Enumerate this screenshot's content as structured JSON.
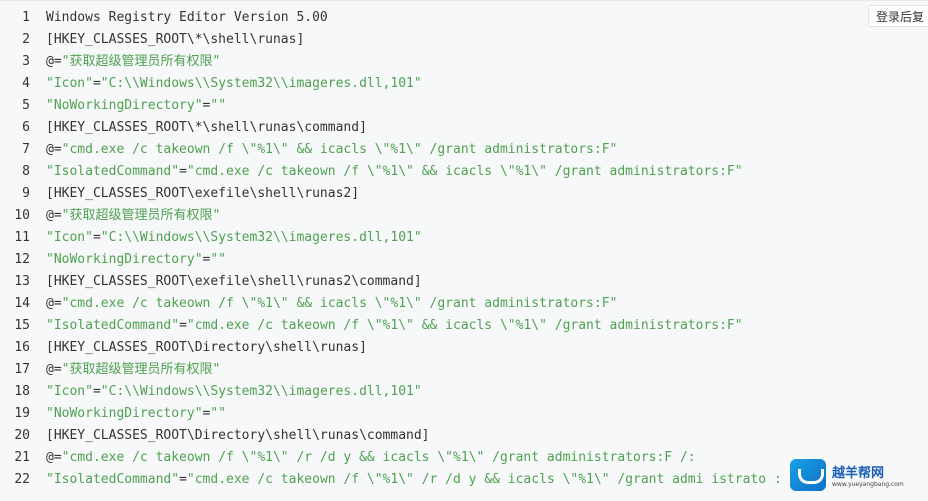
{
  "header": {
    "login_label": "登录后复"
  },
  "lines": [
    {
      "n": "1",
      "segs": [
        {
          "t": "Windows Registry Editor Version 5.00",
          "s": "plain"
        }
      ]
    },
    {
      "n": "2",
      "segs": [
        {
          "t": "[HKEY_CLASSES_ROOT\\*\\shell\\runas]",
          "s": "plain"
        }
      ]
    },
    {
      "n": "3",
      "segs": [
        {
          "t": "@=",
          "s": "plain"
        },
        {
          "t": "\"获取超级管理员所有权限\"",
          "s": "str"
        }
      ]
    },
    {
      "n": "4",
      "segs": [
        {
          "t": "\"Icon\"",
          "s": "str"
        },
        {
          "t": "=",
          "s": "plain"
        },
        {
          "t": "\"C:\\\\Windows\\\\System32\\\\imageres.dll,101\"",
          "s": "str"
        }
      ]
    },
    {
      "n": "5",
      "segs": [
        {
          "t": "\"NoWorkingDirectory\"",
          "s": "str"
        },
        {
          "t": "=",
          "s": "plain"
        },
        {
          "t": "\"\"",
          "s": "str"
        }
      ]
    },
    {
      "n": "6",
      "segs": [
        {
          "t": "[HKEY_CLASSES_ROOT\\*\\shell\\runas\\command]",
          "s": "plain"
        }
      ]
    },
    {
      "n": "7",
      "segs": [
        {
          "t": "@=",
          "s": "plain"
        },
        {
          "t": "\"cmd.exe /c takeown /f \\\"%1\\\" && icacls \\\"%1\\\" /grant administrators:F\"",
          "s": "str"
        }
      ]
    },
    {
      "n": "8",
      "segs": [
        {
          "t": "\"IsolatedCommand\"",
          "s": "str"
        },
        {
          "t": "=",
          "s": "plain"
        },
        {
          "t": "\"cmd.exe /c takeown /f \\\"%1\\\" && icacls \\\"%1\\\" /grant administrators:F\"",
          "s": "str"
        }
      ]
    },
    {
      "n": "9",
      "segs": [
        {
          "t": "[HKEY_CLASSES_ROOT\\exefile\\shell\\runas2]",
          "s": "plain"
        }
      ]
    },
    {
      "n": "10",
      "segs": [
        {
          "t": "@=",
          "s": "plain"
        },
        {
          "t": "\"获取超级管理员所有权限\"",
          "s": "str"
        }
      ]
    },
    {
      "n": "11",
      "segs": [
        {
          "t": "\"Icon\"",
          "s": "str"
        },
        {
          "t": "=",
          "s": "plain"
        },
        {
          "t": "\"C:\\\\Windows\\\\System32\\\\imageres.dll,101\"",
          "s": "str"
        }
      ]
    },
    {
      "n": "12",
      "segs": [
        {
          "t": "\"NoWorkingDirectory\"",
          "s": "str"
        },
        {
          "t": "=",
          "s": "plain"
        },
        {
          "t": "\"\"",
          "s": "str"
        }
      ]
    },
    {
      "n": "13",
      "segs": [
        {
          "t": "[HKEY_CLASSES_ROOT\\exefile\\shell\\runas2\\command]",
          "s": "plain"
        }
      ]
    },
    {
      "n": "14",
      "segs": [
        {
          "t": "@=",
          "s": "plain"
        },
        {
          "t": "\"cmd.exe /c takeown /f \\\"%1\\\" && icacls \\\"%1\\\" /grant administrators:F\"",
          "s": "str"
        }
      ]
    },
    {
      "n": "15",
      "segs": [
        {
          "t": "\"IsolatedCommand\"",
          "s": "str"
        },
        {
          "t": "=",
          "s": "plain"
        },
        {
          "t": "\"cmd.exe /c takeown /f \\\"%1\\\" && icacls \\\"%1\\\" /grant administrators:F\"",
          "s": "str"
        }
      ]
    },
    {
      "n": "16",
      "segs": [
        {
          "t": "[HKEY_CLASSES_ROOT\\Directory\\shell\\runas]",
          "s": "plain"
        }
      ]
    },
    {
      "n": "17",
      "segs": [
        {
          "t": "@=",
          "s": "plain"
        },
        {
          "t": "\"获取超级管理员所有权限\"",
          "s": "str"
        }
      ]
    },
    {
      "n": "18",
      "segs": [
        {
          "t": "\"Icon\"",
          "s": "str"
        },
        {
          "t": "=",
          "s": "plain"
        },
        {
          "t": "\"C:\\\\Windows\\\\System32\\\\imageres.dll,101\"",
          "s": "str"
        }
      ]
    },
    {
      "n": "19",
      "segs": [
        {
          "t": "\"NoWorkingDirectory\"",
          "s": "str"
        },
        {
          "t": "=",
          "s": "plain"
        },
        {
          "t": "\"\"",
          "s": "str"
        }
      ]
    },
    {
      "n": "20",
      "segs": [
        {
          "t": "[HKEY_CLASSES_ROOT\\Directory\\shell\\runas\\command]",
          "s": "plain"
        }
      ]
    },
    {
      "n": "21",
      "segs": [
        {
          "t": "@=",
          "s": "plain"
        },
        {
          "t": "\"cmd.exe /c takeown /f \\\"%1\\\" /r /d y && icacls \\\"%1\\\" /grant administrators:F /:",
          "s": "str"
        }
      ]
    },
    {
      "n": "22",
      "segs": [
        {
          "t": "\"IsolatedCommand\"",
          "s": "str"
        },
        {
          "t": "=",
          "s": "plain"
        },
        {
          "t": "\"cmd.exe /c takeown /f \\\"%1\\\" /r /d y && icacls \\\"%1\\\" /grant admi istrato :",
          "s": "str"
        }
      ]
    }
  ],
  "watermark": {
    "cn": "越羊帮网",
    "url": "www.yueyangbang.com"
  }
}
